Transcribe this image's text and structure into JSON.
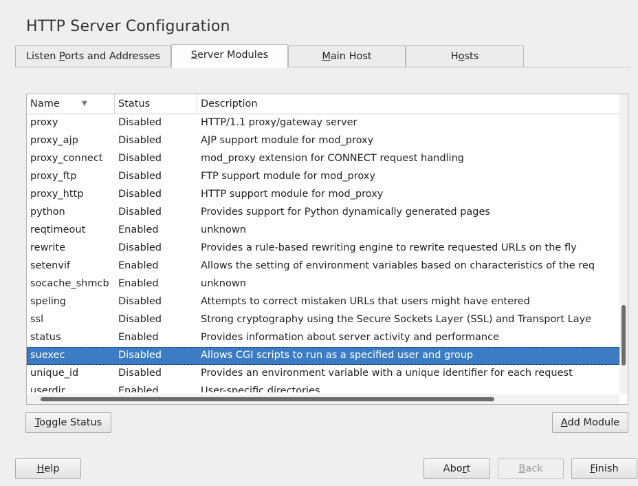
{
  "window": {
    "title": "HTTP Server Configuration"
  },
  "tabs": [
    {
      "label": "Listen Ports and Addresses",
      "pre": "Listen ",
      "mn": "P",
      "post": "orts and Addresses"
    },
    {
      "label": "Server Modules",
      "pre": "",
      "mn": "S",
      "post": "erver Modules",
      "active": true
    },
    {
      "label": "Main Host",
      "pre": "",
      "mn": "M",
      "post": "ain Host"
    },
    {
      "label": "Hosts",
      "pre": "H",
      "mn": "o",
      "post": "sts"
    }
  ],
  "table": {
    "columns": [
      "Name",
      "Status",
      "Description"
    ],
    "sort_indicator": "▼",
    "rows": [
      {
        "name": "proxy",
        "status": "Disabled",
        "description": "HTTP/1.1 proxy/gateway server"
      },
      {
        "name": "proxy_ajp",
        "status": "Disabled",
        "description": "AJP support module for mod_proxy"
      },
      {
        "name": "proxy_connect",
        "status": "Disabled",
        "description": "mod_proxy extension for CONNECT request handling"
      },
      {
        "name": "proxy_ftp",
        "status": "Disabled",
        "description": "FTP support module for mod_proxy"
      },
      {
        "name": "proxy_http",
        "status": "Disabled",
        "description": "HTTP support module for mod_proxy"
      },
      {
        "name": "python",
        "status": "Disabled",
        "description": "Provides support for Python dynamically generated pages"
      },
      {
        "name": "reqtimeout",
        "status": "Enabled",
        "description": "unknown"
      },
      {
        "name": "rewrite",
        "status": "Disabled",
        "description": "Provides a rule-based rewriting engine to rewrite requested URLs on the fly"
      },
      {
        "name": "setenvif",
        "status": "Enabled",
        "description": "Allows the setting of environment variables based on characteristics of the req"
      },
      {
        "name": "socache_shmcb",
        "status": "Enabled",
        "description": "unknown"
      },
      {
        "name": "speling",
        "status": "Disabled",
        "description": "Attempts to correct mistaken URLs that users might have entered"
      },
      {
        "name": "ssl",
        "status": "Disabled",
        "description": "Strong cryptography using the Secure Sockets Layer (SSL) and Transport Laye"
      },
      {
        "name": "status",
        "status": "Enabled",
        "description": "Provides information about server activity and performance"
      },
      {
        "name": "suexec",
        "status": "Disabled",
        "description": "Allows CGI scripts to run as a specified user and group",
        "selected": true
      },
      {
        "name": "unique_id",
        "status": "Disabled",
        "description": "Provides an environment variable with a unique identifier for each request"
      },
      {
        "name": "userdir",
        "status": "Enabled",
        "description": "User-specific directories"
      }
    ]
  },
  "buttons": {
    "toggle_status": {
      "label": "Toggle Status",
      "pre": "",
      "mn": "T",
      "post": "oggle Status"
    },
    "add_module": {
      "label": "Add Module",
      "pre": "",
      "mn": "A",
      "post": "dd Module"
    },
    "help": {
      "label": "Help",
      "pre": "",
      "mn": "H",
      "post": "elp"
    },
    "abort": {
      "label": "Abort",
      "pre": "Abo",
      "mn": "r",
      "post": "t"
    },
    "back": {
      "label": "Back",
      "pre": "",
      "mn": "B",
      "post": "ack",
      "disabled": true
    },
    "finish": {
      "label": "Finish",
      "pre": "",
      "mn": "F",
      "post": "inish"
    }
  },
  "colors": {
    "selection": "#3b7cc4",
    "background": "#efefef"
  }
}
